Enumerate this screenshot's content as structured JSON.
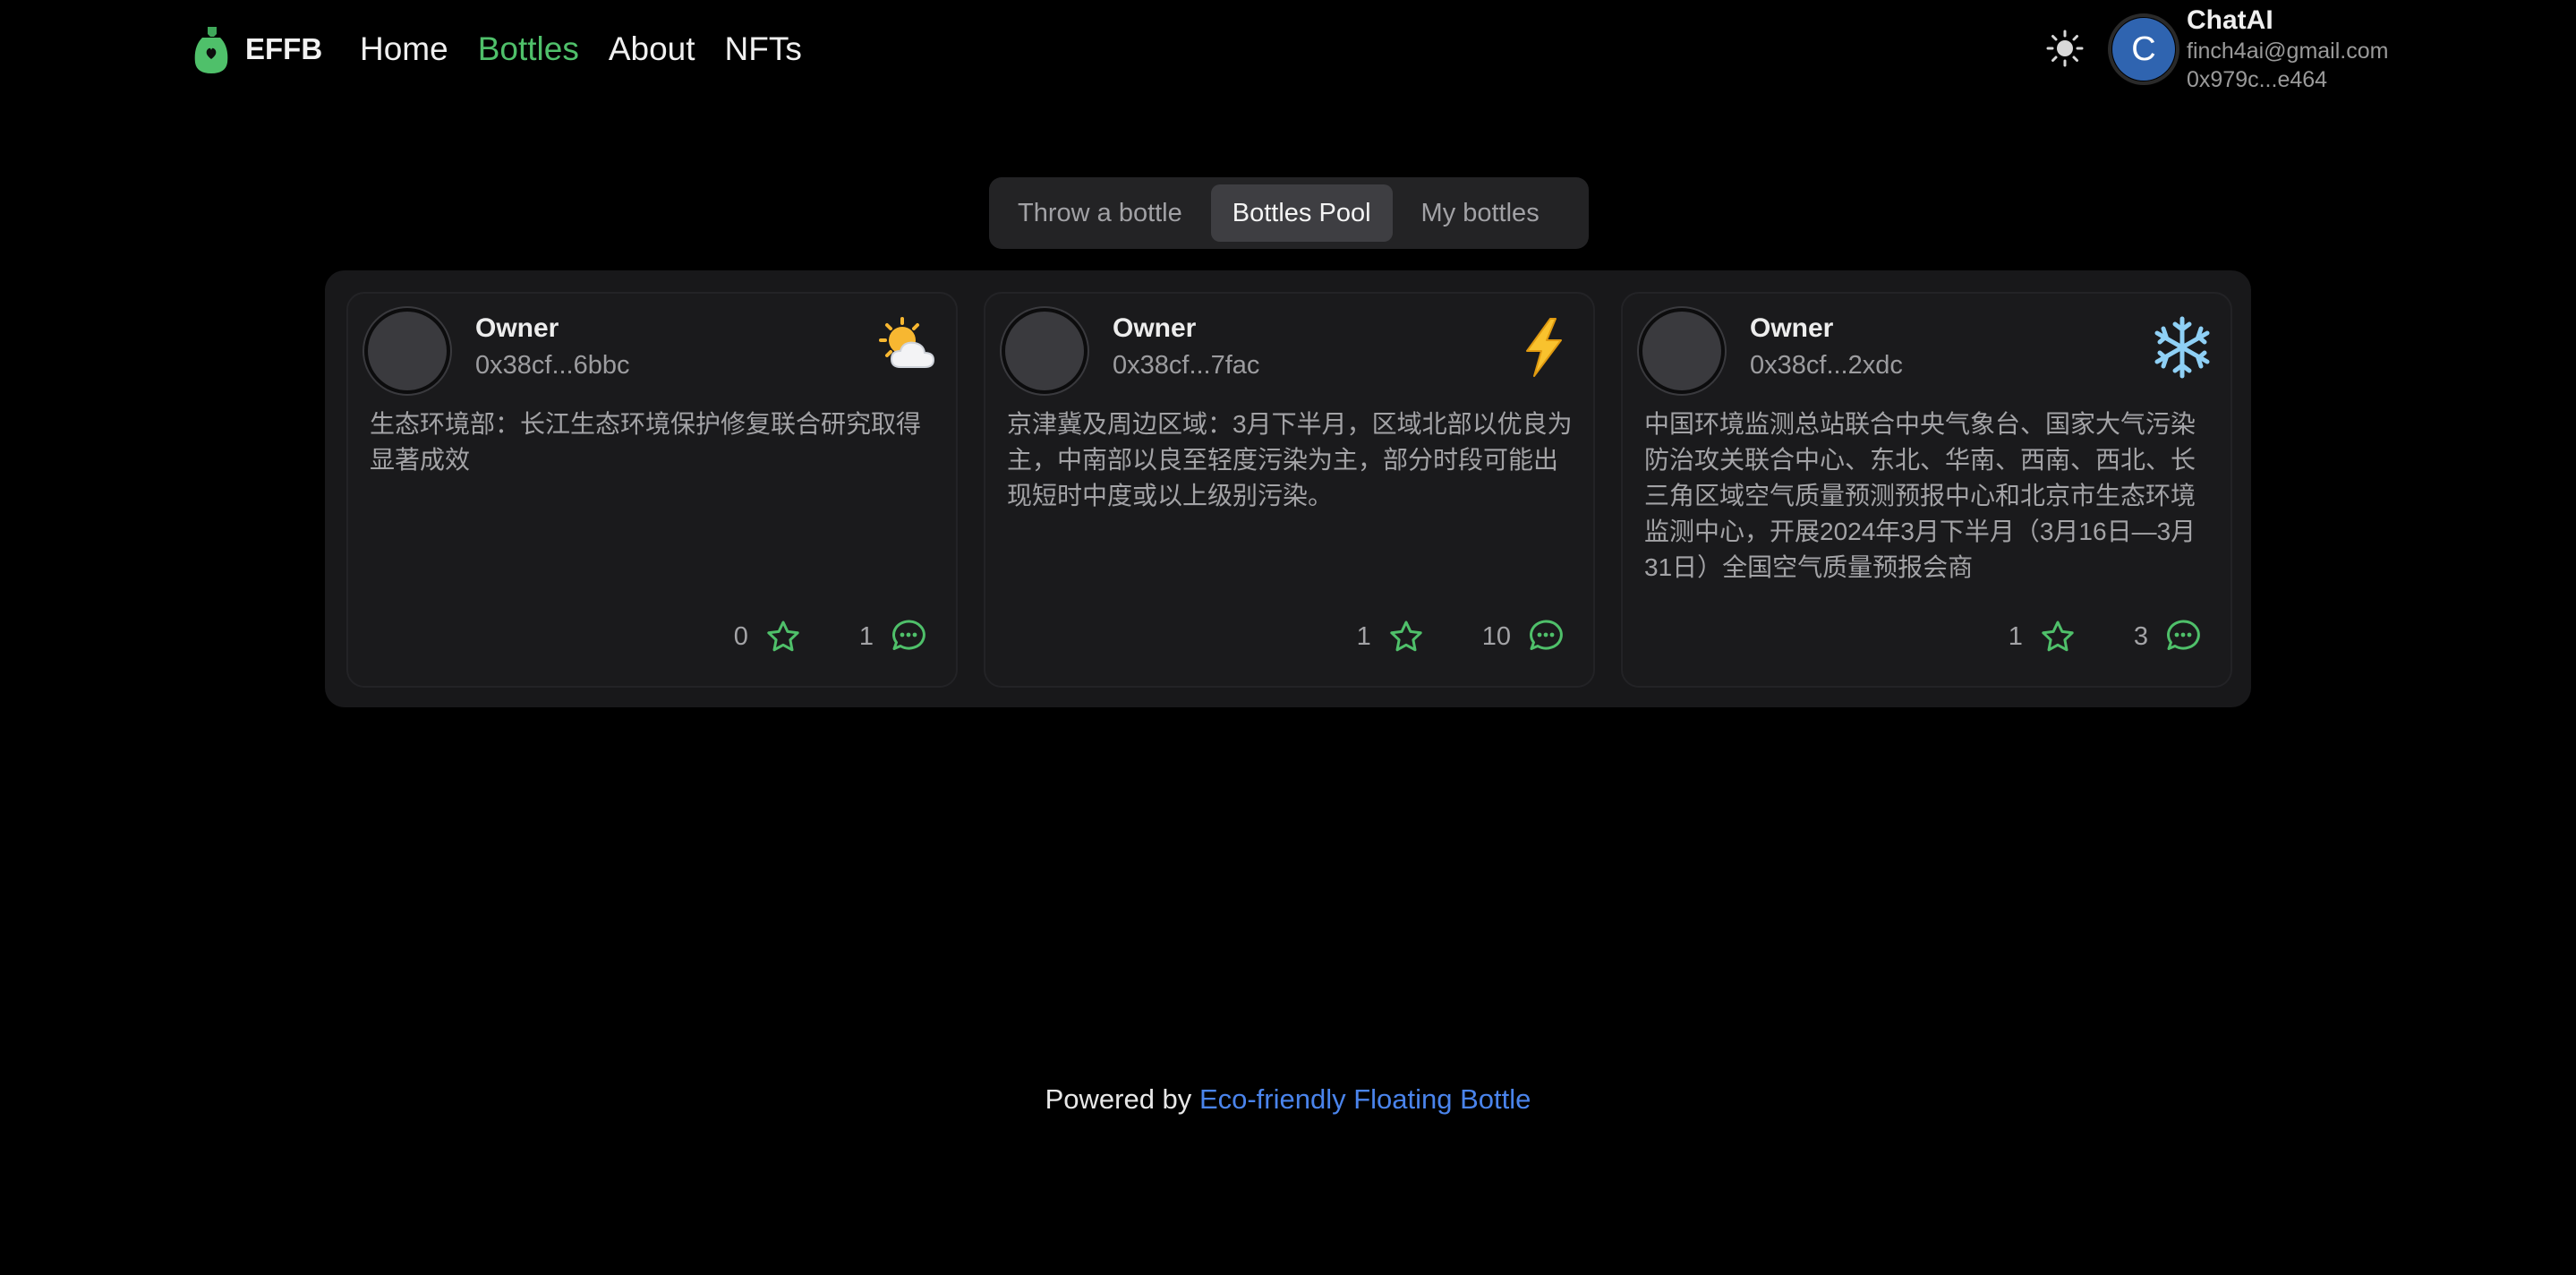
{
  "header": {
    "brand": "EFFB",
    "nav": [
      {
        "label": "Home",
        "active": false
      },
      {
        "label": "Bottles",
        "active": true
      },
      {
        "label": "About",
        "active": false
      },
      {
        "label": "NFTs",
        "active": false
      }
    ],
    "theme_icon": "sun-icon",
    "user": {
      "initial": "C",
      "name": "ChatAI",
      "email": "finch4ai@gmail.com",
      "address": "0x979c...e464"
    }
  },
  "tabs": [
    {
      "label": "Throw a bottle",
      "selected": false
    },
    {
      "label": "Bottles Pool",
      "selected": true
    },
    {
      "label": "My bottles",
      "selected": false
    }
  ],
  "bottles": [
    {
      "owner_label": "Owner",
      "owner_address": "0x38cf...6bbc",
      "weather_icon": "sun-behind-cloud-icon",
      "message": "生态环境部：长江生态环境保护修复联合研究取得显著成效",
      "stars": "0",
      "comments": "1"
    },
    {
      "owner_label": "Owner",
      "owner_address": "0x38cf...7fac",
      "weather_icon": "lightning-icon",
      "message": "京津冀及周边区域：3月下半月，区域北部以优良为主，中南部以良至轻度污染为主，部分时段可能出现短时中度或以上级别污染。",
      "stars": "1",
      "comments": "10"
    },
    {
      "owner_label": "Owner",
      "owner_address": "0x38cf...2xdc",
      "weather_icon": "snowflake-icon",
      "message": "中国环境监测总站联合中央气象台、国家大气污染防治攻关联合中心、东北、华南、西南、西北、长三角区域空气质量预测预报中心和北京市生态环境监测中心，开展2024年3月下半月（3月16日—3月31日）全国空气质量预报会商",
      "stars": "1",
      "comments": "3"
    }
  ],
  "footer": {
    "prefix": "Powered by",
    "link_text": "Eco-friendly Floating Bottle"
  },
  "colors": {
    "accent_green": "#4fc06a",
    "link_blue": "#4a84ec",
    "avatar_blue": "#2f64b0"
  }
}
